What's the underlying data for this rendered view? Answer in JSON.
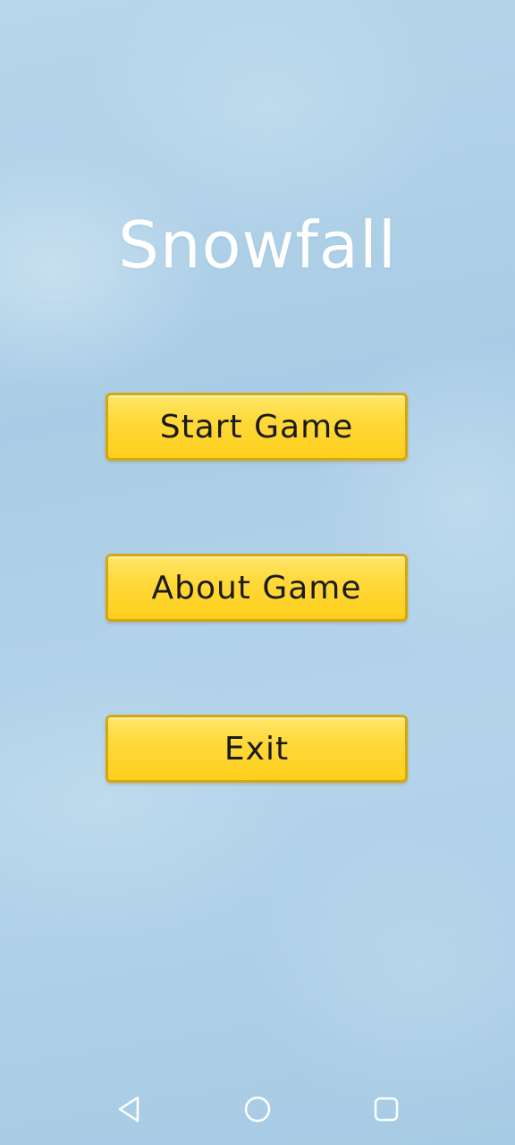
{
  "title": "Snowfall",
  "menu": {
    "start_label": "Start Game",
    "about_label": "About Game",
    "exit_label": "Exit"
  },
  "navigation": {
    "back_icon": "back-triangle-icon",
    "home_icon": "home-circle-icon",
    "recent_icon": "recent-apps-square-icon"
  },
  "colors": {
    "button_fill": "#ffd93a",
    "button_border": "#d6a611",
    "title_text": "#ffffff",
    "background": "#acd0e7"
  }
}
